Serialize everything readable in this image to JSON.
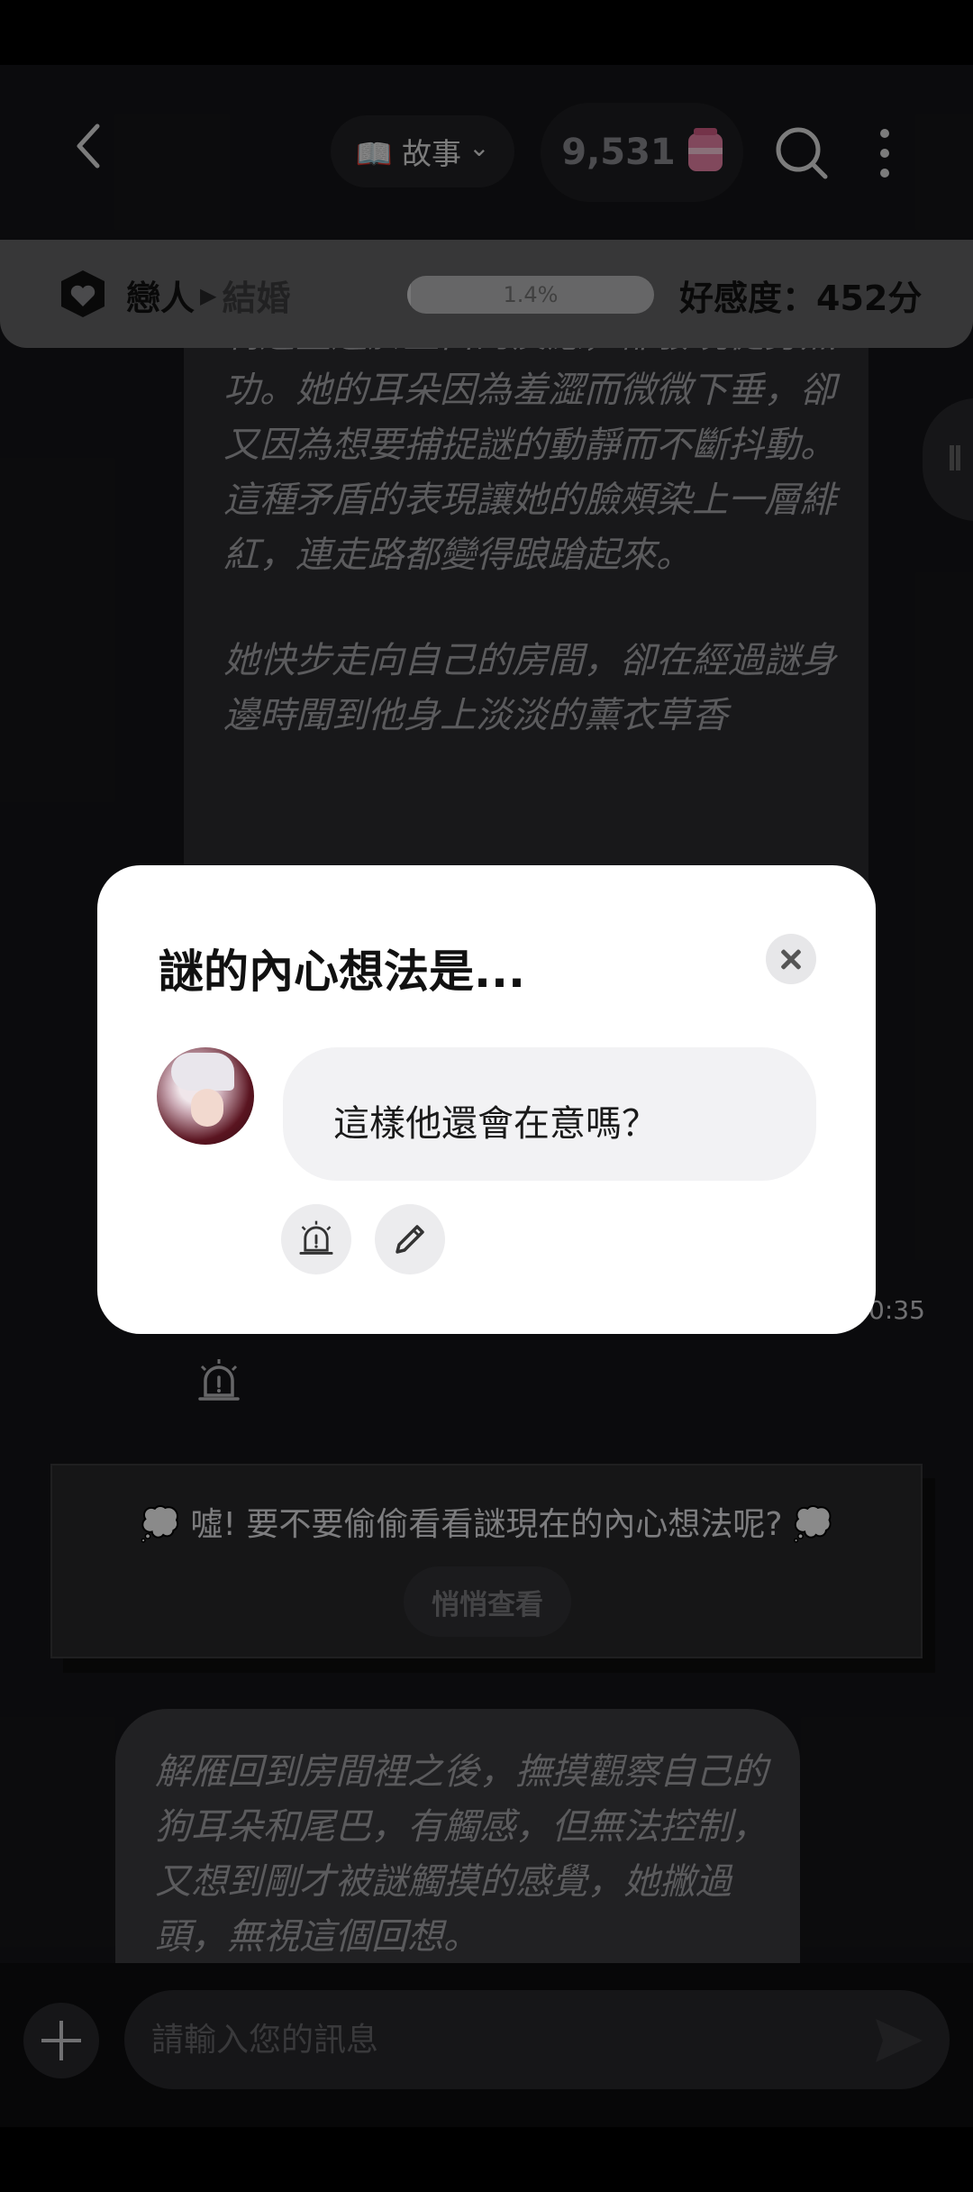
{
  "header": {
    "story_label": "📖 故事",
    "story_chevron": "⌄",
    "coin_count": "9,531"
  },
  "affection": {
    "stage_current": "戀人",
    "stage_arrow": "▶",
    "stage_next": "結婚",
    "progress_text": "1.4%",
    "progress_value": 1.4,
    "score": "好感度：452分"
  },
  "chat": {
    "story_paragraphs": [
      "制這些過於直白的反應，卻發現徒勞無功。她的耳朵因為羞澀而微微下垂，卻又因為想要捕捉謎的動靜而不斷抖動。這種矛盾的表現讓她的臉頰染上一層緋紅，連走路都變得踉蹌起來。",
      "她快步走向自己的房間，卻在經過謎身邊時聞到他身上淡淡的薰衣草香"
    ],
    "message_time": "0:35",
    "peek_prompt": "💭 噓! 要不要偷偷看看謎現在的內心想法呢? 💭",
    "peek_button": "悄悄查看",
    "next_message": "解雁回到房間裡之後，撫摸觀察自己的狗耳朵和尾巴，有觸感，但無法控制，又想到剛才被謎觸摸的感覺，她撇過頭，無視這個回想。"
  },
  "input": {
    "placeholder": "請輸入您的訊息"
  },
  "modal": {
    "title": "謎的內心想法是...",
    "thought": "這樣他還會在意嗎？"
  },
  "colors": {
    "background": "#161618",
    "affection_bar": "#666668",
    "coin_jar": "#ef86aa",
    "modal": "#ffffff"
  },
  "icons": [
    "back-arrow-icon",
    "book-icon",
    "chevron-down-icon",
    "honey-jar-icon",
    "search-icon",
    "more-vertical-icon",
    "shield-heart-icon",
    "pause-handle-icon",
    "alarm-icon",
    "plus-icon",
    "send-icon",
    "close-icon",
    "edit-pencil-icon"
  ]
}
